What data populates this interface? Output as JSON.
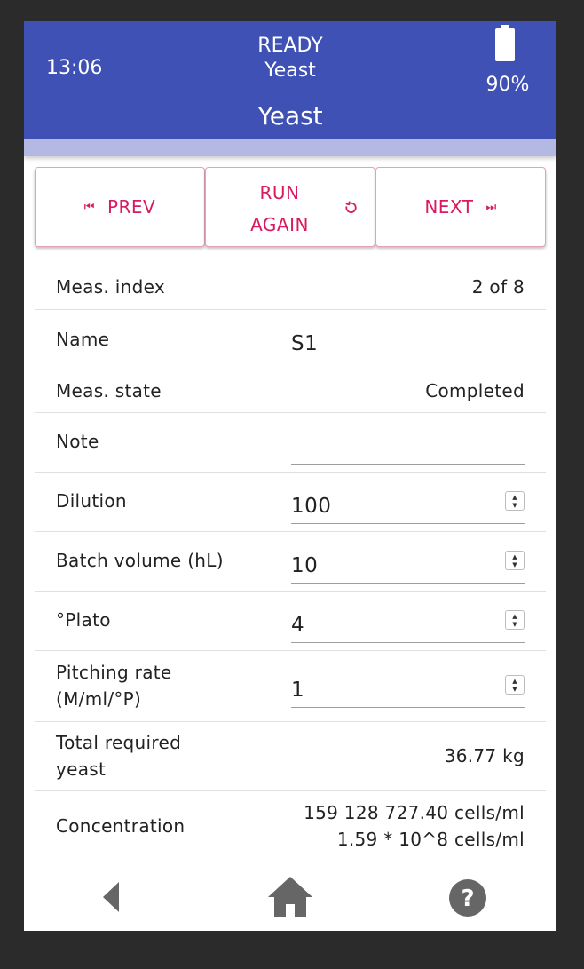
{
  "header": {
    "time": "13:06",
    "status_line1": "READY",
    "status_line2": "Yeast",
    "title": "Yeast",
    "battery": "90%"
  },
  "actions": {
    "prev": "PREV",
    "run_again_line1": "RUN",
    "run_again_line2": "AGAIN",
    "next": "NEXT"
  },
  "fields": {
    "meas_index": {
      "label": "Meas. index",
      "value": "2 of 8"
    },
    "name": {
      "label": "Name",
      "value": "S1"
    },
    "meas_state": {
      "label": "Meas. state",
      "value": "Completed"
    },
    "note": {
      "label": "Note",
      "value": ""
    },
    "dilution": {
      "label": "Dilution",
      "value": "100"
    },
    "batch_volume": {
      "label": "Batch volume (hL)",
      "value": "10"
    },
    "plato": {
      "label": "°Plato",
      "value": "4"
    },
    "pitching_rate": {
      "label_line1": "Pitching rate",
      "label_line2": "(M/ml/°P)",
      "value": "1"
    },
    "total_required_yeast": {
      "label_line1": "Total required",
      "label_line2": "yeast",
      "value": "36.77 kg"
    },
    "concentration": {
      "label": "Concentration",
      "value_line1": "159 128 727.40 cells/ml",
      "value_line2": "1.59 * 10^8 cells/ml"
    }
  },
  "nav": {
    "back_icon": "back-icon",
    "home_icon": "home-icon",
    "help_icon": "help-icon"
  },
  "colors": {
    "header": "#3f51b5",
    "header_sub": "#b3b9e3",
    "accent": "#d81b60",
    "nav_icon": "#666666"
  }
}
